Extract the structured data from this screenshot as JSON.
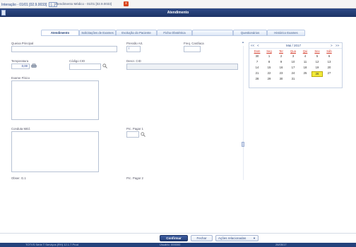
{
  "window": {
    "breadcrumb": "Interação - 01/01 [02.9.0033]",
    "breadcrumb_box": "[...]",
    "subtitle": "Atendimento Médico - 01/01 [02.9.0033]",
    "close_glyph": "x",
    "title": "Atendimento"
  },
  "tabs": [
    {
      "label": "Atendimento",
      "active": true
    },
    {
      "label": "Solicitações de Exames",
      "active": false
    },
    {
      "label": "Evolução do Paciente",
      "active": false
    },
    {
      "label": "Ficha Obstétrica",
      "active": false
    },
    {
      "label": "",
      "active": false
    },
    {
      "label": "Questionários",
      "active": false
    },
    {
      "label": "Histórico Exames",
      "active": false
    }
  ],
  "form": {
    "queixa_label": "Queixa Principal",
    "pressao_label": "Pressão Art.",
    "pressao_value": "/",
    "freq_label": "Freq. Cardíaca",
    "temp_label": "Temperatura",
    "temp_value": "0,00",
    "cid_label": "Código CID",
    "desc_cid_label": "Descr. CID",
    "exame_label": "Exame Físico",
    "conduta_label": "Conduta Méd.",
    "proc_label": "Prc. Pagar 1",
    "obs_label": "Obser. G.1",
    "proc2_label": "Prc. Pagar 2"
  },
  "icons": {
    "scale": "scale-icon",
    "search": "search-icon",
    "scroll_up": "chevron-up-icon"
  },
  "calendar": {
    "nav_first": "<<",
    "nav_prev": "<",
    "month_year": "Mai / 2017",
    "nav_next": ">",
    "nav_last": ">>",
    "weekdays": [
      "Dom",
      "Seg",
      "Ter",
      "Qua",
      "Qui",
      "Sex",
      "Sáb"
    ],
    "weeks": [
      [
        "30",
        "1",
        "2",
        "3",
        "4",
        "5",
        "6"
      ],
      [
        "7",
        "8",
        "9",
        "10",
        "11",
        "12",
        "13"
      ],
      [
        "14",
        "15",
        "16",
        "17",
        "18",
        "19",
        "20"
      ],
      [
        "21",
        "22",
        "23",
        "24",
        "25",
        "26",
        "27"
      ],
      [
        "28",
        "29",
        "30",
        "31",
        "",
        "",
        ""
      ]
    ],
    "today": "26"
  },
  "footer": {
    "confirm_label": "Confirmar",
    "close_label": "Fechar",
    "actions_label": "Ações relacionadas",
    "actions_caret": "▼"
  },
  "statusbar": {
    "left": "TOTVS Série T Serviços (RH) 12.1.7 Prod",
    "mid": "Usuário: 000000",
    "right": "26/05/17"
  },
  "colors": {
    "title_bar": "#24427c",
    "accent": "#f2ea38",
    "weekday": "#d63b2a"
  }
}
